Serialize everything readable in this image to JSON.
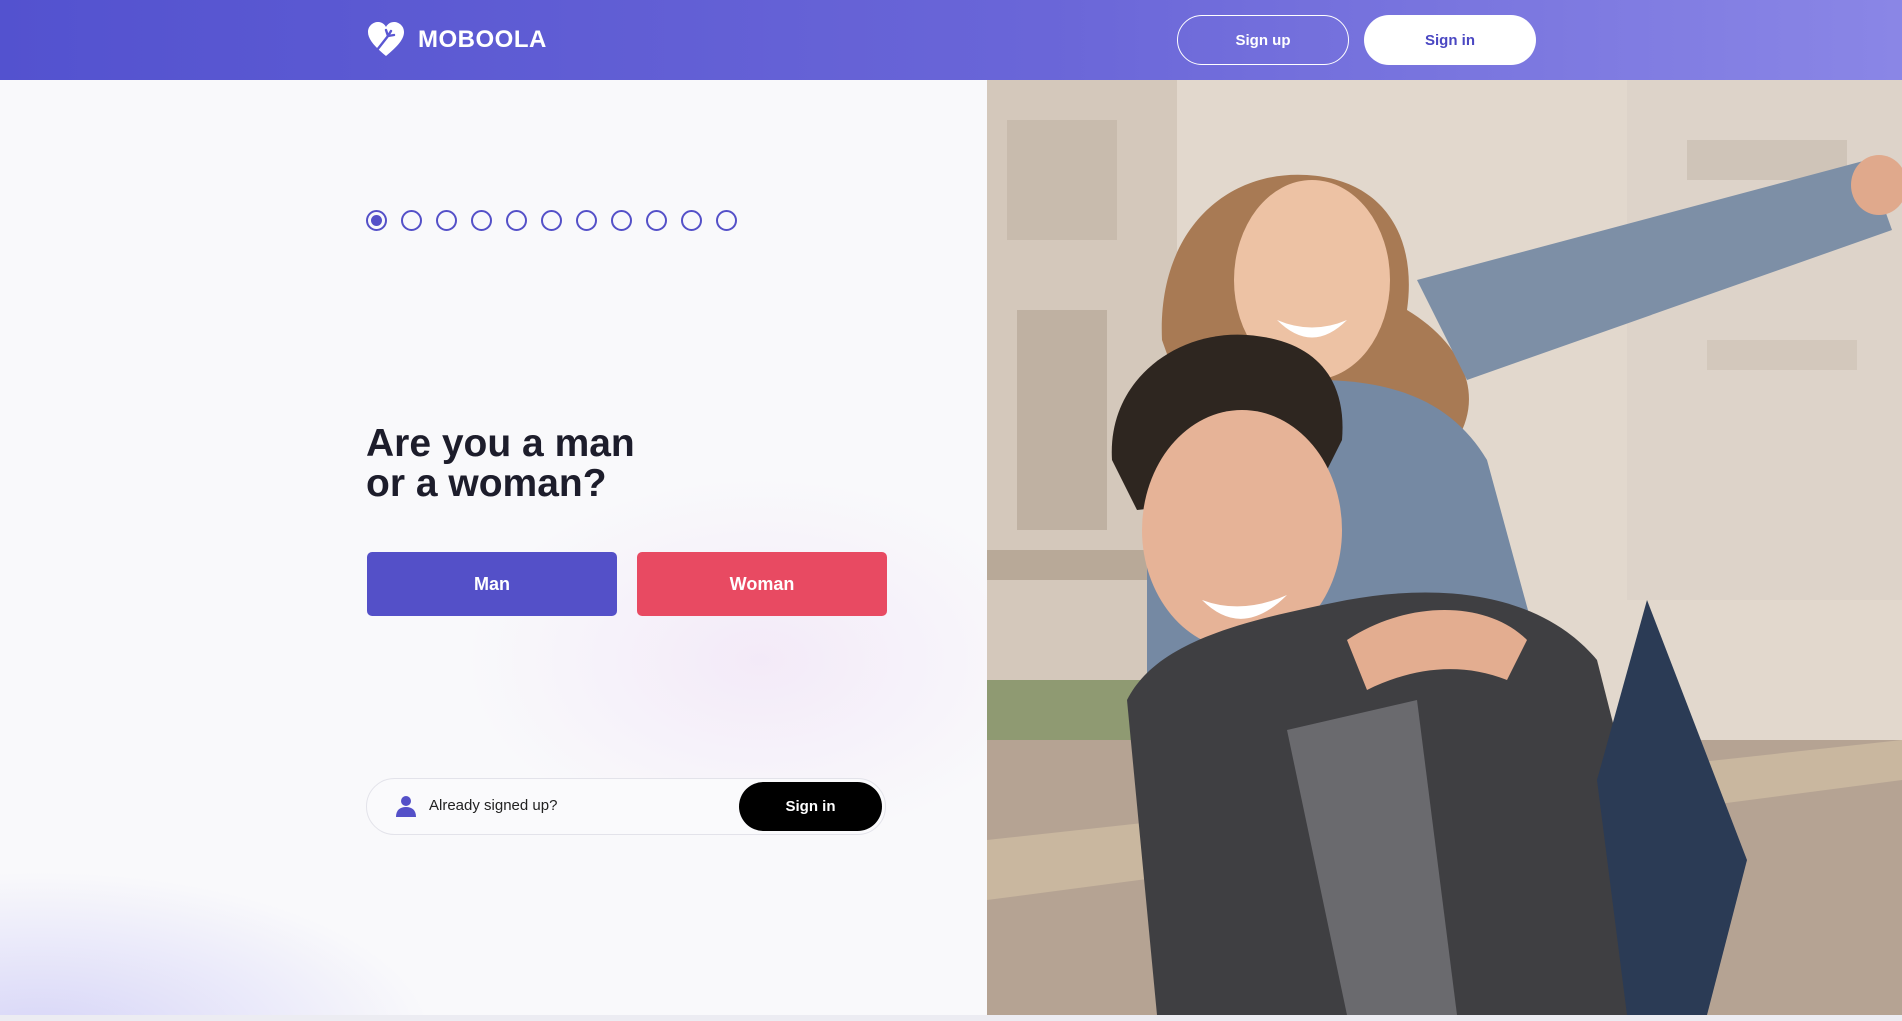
{
  "header": {
    "brand": "MOBOOLA",
    "logo_icon": "heart-logo-icon",
    "signup_label": "Sign up",
    "signin_label": "Sign in"
  },
  "progress": {
    "total_steps": 11,
    "current_step": 1
  },
  "question": {
    "line1": "Are you a man",
    "line2": "or a woman?"
  },
  "choices": {
    "man_label": "Man",
    "woman_label": "Woman"
  },
  "signed_up": {
    "icon": "user-icon",
    "prompt": "Already signed up?",
    "button_label": "Sign in"
  },
  "colors": {
    "accent": "#5450c8",
    "woman": "#e84a62",
    "header_start": "#5352cf",
    "header_end": "#8a86e6"
  }
}
